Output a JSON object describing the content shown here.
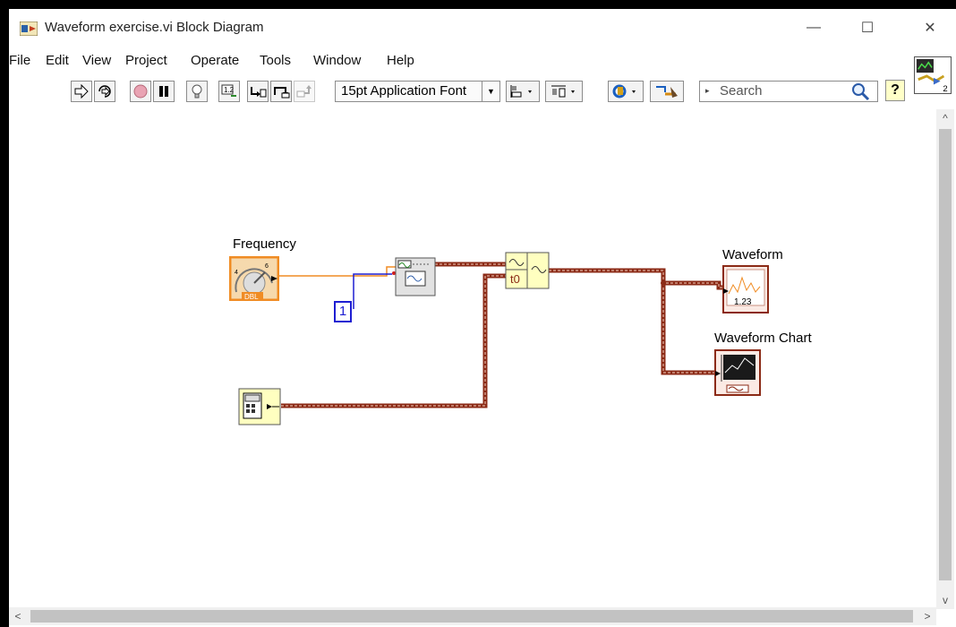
{
  "window": {
    "title": "Waveform exercise.vi Block Diagram",
    "controls": {
      "minimize": "—",
      "maximize": "☐",
      "close": "✕"
    }
  },
  "menu": [
    "File",
    "Edit",
    "View",
    "Project",
    "Operate",
    "Tools",
    "Window",
    "Help"
  ],
  "toolbar": {
    "font": "15pt Application Font",
    "search_placeholder": "Search",
    "help": "?"
  },
  "diagram": {
    "frequency_label": "Frequency",
    "frequency_type": "DBL",
    "constant_value": "1",
    "t0_label": "t0",
    "waveform_label": "Waveform",
    "waveform_chart_label": "Waveform Chart",
    "waveform_terminal_value": "1.23",
    "connector_number": "2"
  },
  "colors": {
    "dbl_wire": "#f08c24",
    "int_wire": "#1e1ed2",
    "waveform_wire": "#8b2a16",
    "node_yellow": "#ffffc0",
    "frequency_terminal": "#f08c24"
  },
  "scrollbars": {
    "up": "^",
    "down": "v",
    "left": "<",
    "right": ">"
  }
}
